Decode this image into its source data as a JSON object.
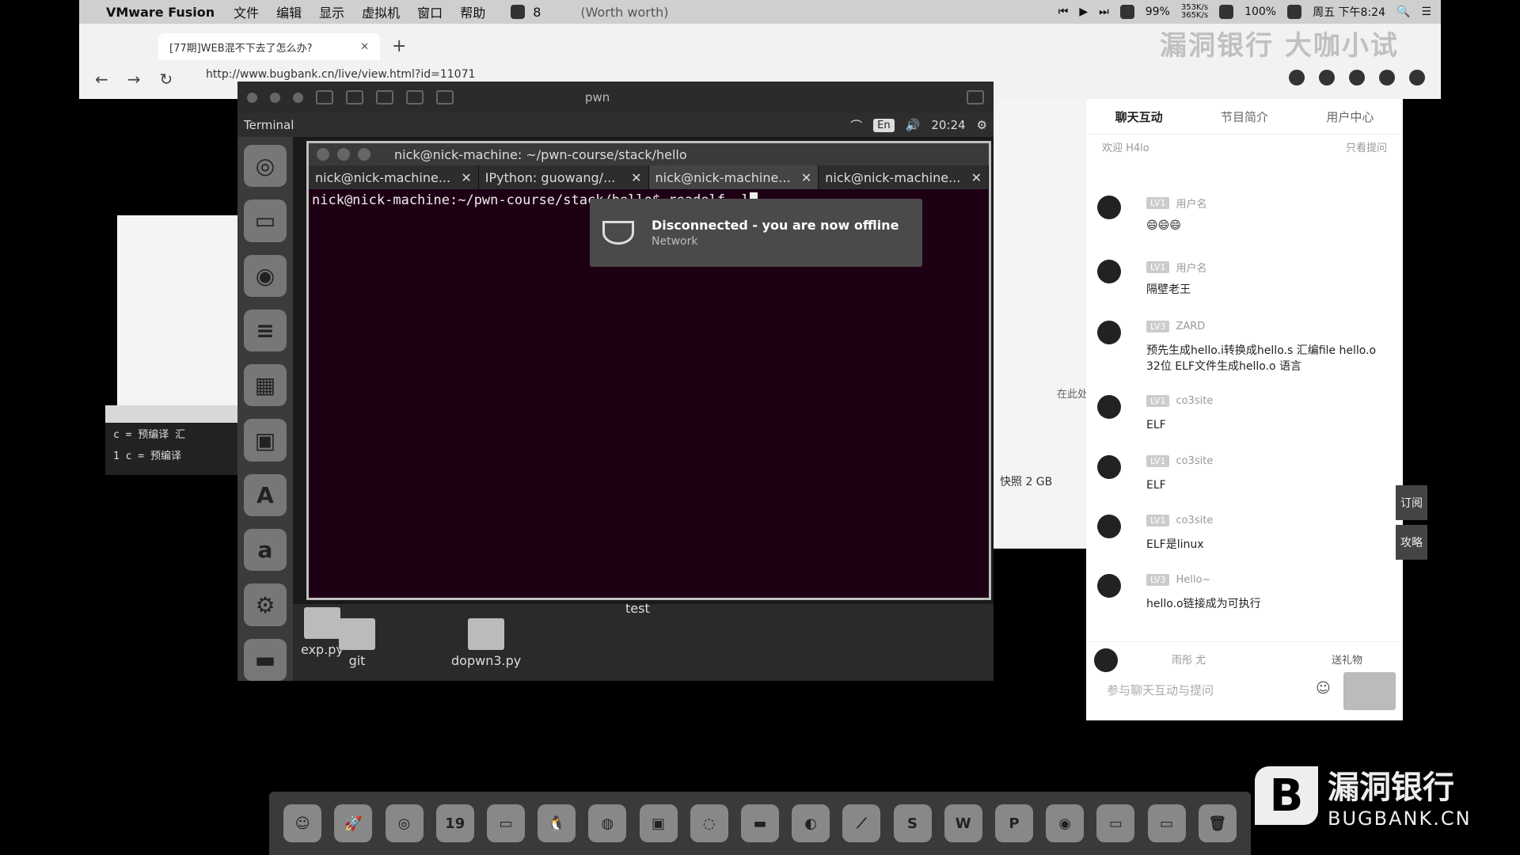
{
  "menubar": {
    "app_name": "VMware Fusion",
    "menus": [
      "文件",
      "编辑",
      "显示",
      "虚拟机",
      "窗口",
      "帮助"
    ],
    "badge_count": "8",
    "now_playing": "(Worth  worth)",
    "battery": "99%",
    "net_up": "353K/s",
    "net_down": "365K/s",
    "volume": "100%",
    "clock": "周五 下午8:24"
  },
  "browser": {
    "tab_title": "[77期]WEB混不下去了怎么办?",
    "url": "http://www.bugbank.cn/live/view.html?id=11071",
    "watermark": "漏洞银行 大咖小试"
  },
  "vm": {
    "title": "pwn",
    "ubuntu_app": "Terminal",
    "lang": "En",
    "time": "20:24",
    "terminal_title": "nick@nick-machine: ~/pwn-course/stack/hello",
    "tabs": [
      {
        "label": "nick@nick-machine..."
      },
      {
        "label": "IPython: guowang/..."
      },
      {
        "label": "nick@nick-machine..."
      },
      {
        "label": "nick@nick-machine..."
      }
    ],
    "prompt": "nick@nick-machine:~/pwn-course/stack/hello$ ",
    "command": "readelf -l",
    "notify_title": "Disconnected - you are now offline",
    "notify_sub": "Network",
    "desktop_files": [
      "exp.py",
      "git",
      "dopwn3.py",
      "test"
    ],
    "launcher_letter": "a"
  },
  "left_code": {
    "line1": "c = 预编译 汇",
    "line2": "1   c  =  预编译"
  },
  "mid_panel": {
    "hint": "在此处添加",
    "snapshot": "快照  2 GB"
  },
  "chat": {
    "tabs": [
      "聊天互动",
      "节目简介",
      "用户中心"
    ],
    "welcome": "欢迎  H4lo",
    "only_questions": "只看提问",
    "messages": [
      {
        "level": "LV1",
        "user": "用户名",
        "text": "😄😄😄"
      },
      {
        "level": "LV1",
        "user": "用户名",
        "text": "隔壁老王"
      },
      {
        "level": "LV3",
        "user": "ZARD",
        "text": "预先生成hello.i转换成hello.s 汇编file hello.o 32位 ELF文件生成hello.o 语言"
      },
      {
        "level": "LV1",
        "user": "co3site",
        "text": "ELF"
      },
      {
        "level": "LV1",
        "user": "co3site",
        "text": "ELF"
      },
      {
        "level": "LV1",
        "user": "co3site",
        "text": "ELF是linux"
      },
      {
        "level": "LV3",
        "user": "Hello~",
        "text": "hello.o链接成为可执行"
      }
    ],
    "self_user": "雨彤 尤",
    "gift": "送礼物",
    "input_placeholder": "参与聊天互动与提问",
    "side_subscribe": "订阅",
    "side_guide": "攻略"
  },
  "dock": {
    "calendar_day": "19"
  },
  "watermark": {
    "cn": "漏洞银行",
    "en": "BUGBANK.CN"
  }
}
